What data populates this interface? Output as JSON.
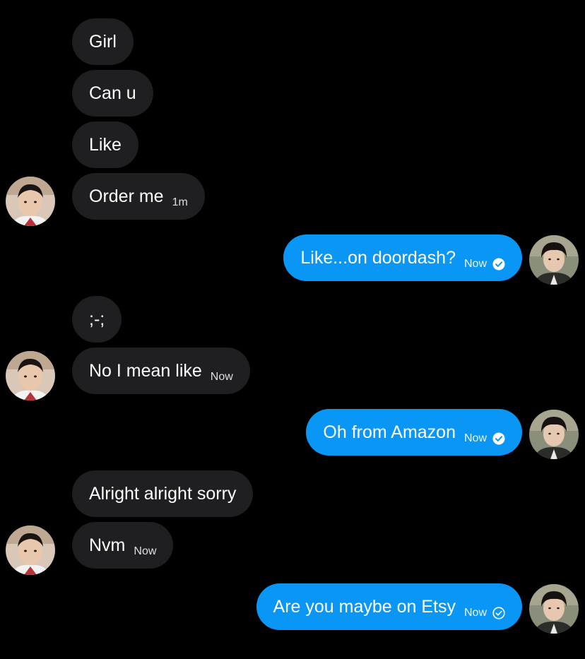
{
  "conversation": {
    "messages": [
      {
        "text": "Girl"
      },
      {
        "text": "Can u"
      },
      {
        "text": "Like"
      },
      {
        "text": "Order me",
        "time": "1m"
      },
      {
        "text": "Like...on doordash?",
        "time": "Now",
        "status": "seen"
      },
      {
        "text": ";-;"
      },
      {
        "text": "No I mean like",
        "time": "Now"
      },
      {
        "text": "Oh from Amazon",
        "time": "Now",
        "status": "seen"
      },
      {
        "text": "Alright alright sorry"
      },
      {
        "text": "Nvm",
        "time": "Now"
      },
      {
        "text": "Are you maybe on Etsy",
        "time": "Now",
        "status": "sent"
      }
    ]
  },
  "colors": {
    "background": "#000000",
    "incoming_bubble": "#1f1f21",
    "outgoing_bubble": "#0a96f5",
    "text": "#ffffff"
  },
  "icons": {
    "seen": "check-circle-filled-icon",
    "sent": "check-circle-outline-icon"
  }
}
